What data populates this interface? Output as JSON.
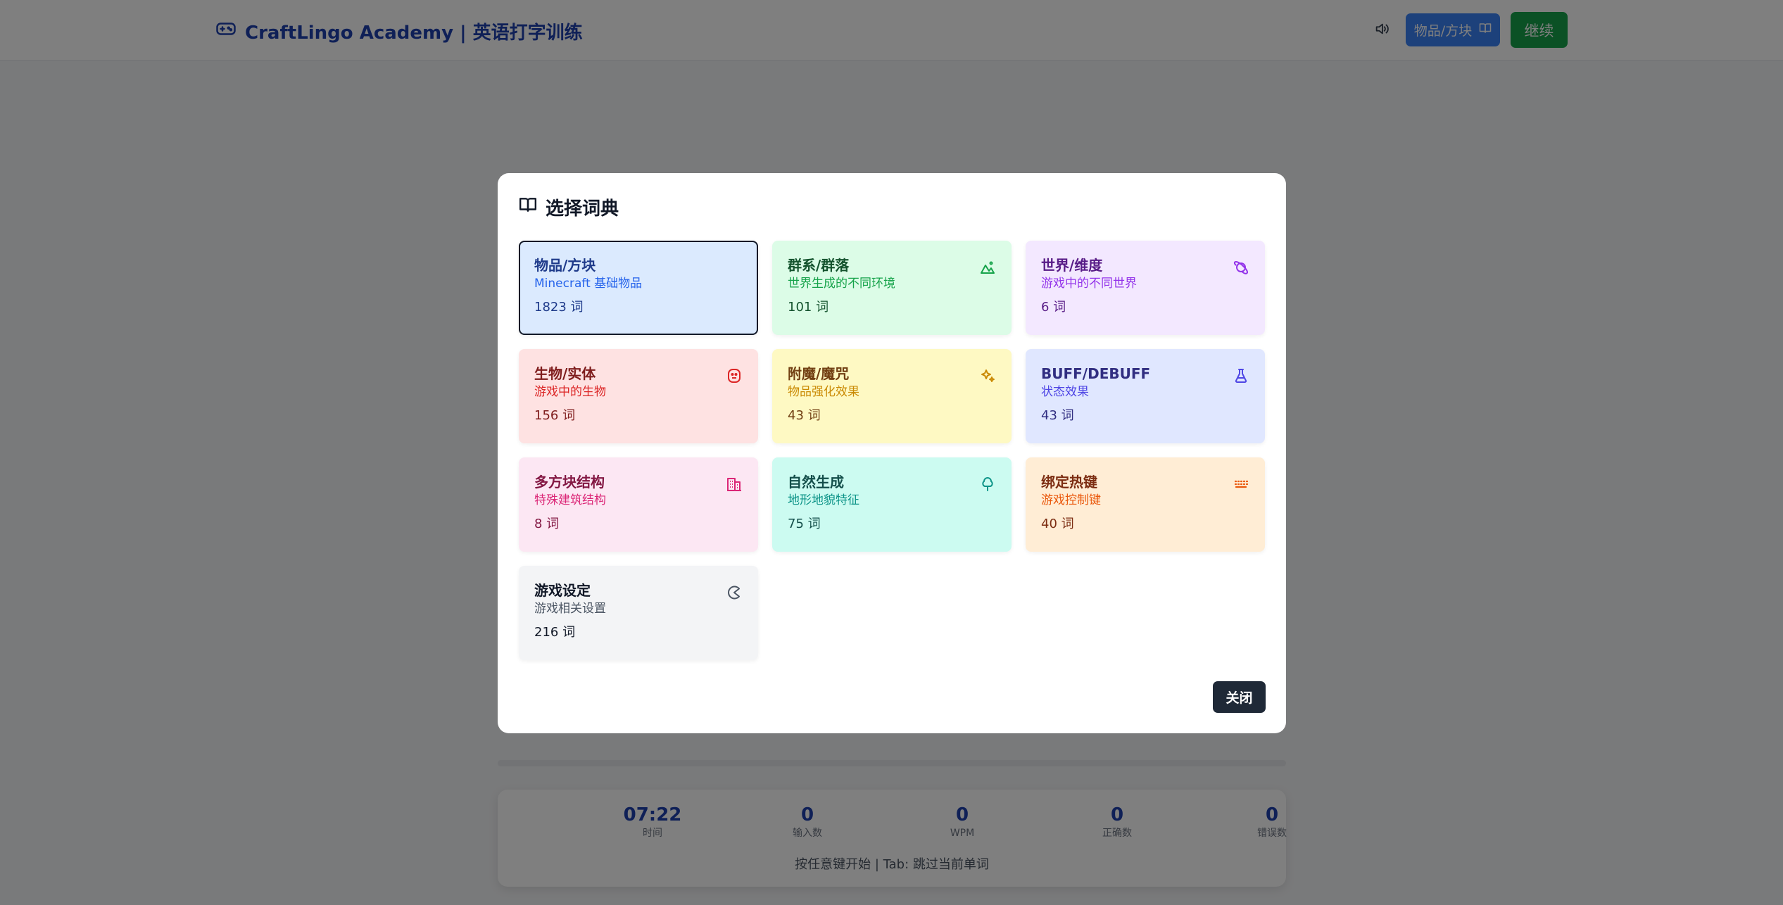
{
  "header": {
    "brand_icon": "gamepad-icon",
    "title": "CraftLingo Academy | 英语打字训练",
    "sound_icon": "speaker-icon",
    "dictionary_button": "物品/方块",
    "dictionary_icon": "book-open-icon",
    "continue_button": "继续",
    "colors": {
      "brand": "#1e40af",
      "primary_button": "#3b82f6",
      "continue_button": "#16a34a"
    }
  },
  "stats": {
    "items": [
      {
        "value": "07:22",
        "label": "时间"
      },
      {
        "value": "0",
        "label": "输入数"
      },
      {
        "value": "0",
        "label": "WPM"
      },
      {
        "value": "0",
        "label": "正确数"
      },
      {
        "value": "0",
        "label": "错误数"
      }
    ],
    "hint": "按任意键开始 | Tab: 跳过当前单词"
  },
  "modal": {
    "title_icon": "book-open-icon",
    "title": "选择词典",
    "close_button": "关闭",
    "dictionaries": [
      {
        "name": "物品/方块",
        "desc": "Minecraft 基础物品",
        "count": "1823 词",
        "icon": "",
        "selected": true,
        "bg": "#dbeafe",
        "fg": "#1e3a8a",
        "sub": "#2563eb"
      },
      {
        "name": "群系/群落",
        "desc": "世界生成的不同环境",
        "count": "101 词",
        "icon": "mountain-icon",
        "selected": false,
        "bg": "#dcfce7",
        "fg": "#14532d",
        "sub": "#16a34a"
      },
      {
        "name": "世界/维度",
        "desc": "游戏中的不同世界",
        "count": "6 词",
        "icon": "planet-icon",
        "selected": false,
        "bg": "#f3e8ff",
        "fg": "#581c87",
        "sub": "#9333ea"
      },
      {
        "name": "生物/实体",
        "desc": "游戏中的生物",
        "count": "156 词",
        "icon": "ghost-icon",
        "selected": false,
        "bg": "#fee2e2",
        "fg": "#7f1d1d",
        "sub": "#dc2626"
      },
      {
        "name": "附魔/魔咒",
        "desc": "物品强化效果",
        "count": "43 词",
        "icon": "sparkles-icon",
        "selected": false,
        "bg": "#fef9c3",
        "fg": "#713f12",
        "sub": "#ca8a04"
      },
      {
        "name": "BUFF/DEBUFF",
        "desc": "状态效果",
        "count": "43 词",
        "icon": "flask-icon",
        "selected": false,
        "bg": "#e0e7ff",
        "fg": "#312e81",
        "sub": "#4f46e5"
      },
      {
        "name": "多方块结构",
        "desc": "特殊建筑结构",
        "count": "8 词",
        "icon": "building-icon",
        "selected": false,
        "bg": "#fce7f3",
        "fg": "#831843",
        "sub": "#db2777"
      },
      {
        "name": "自然生成",
        "desc": "地形地貌特征",
        "count": "75 词",
        "icon": "tree-icon",
        "selected": false,
        "bg": "#ccfbf1",
        "fg": "#134e4a",
        "sub": "#0d9488"
      },
      {
        "name": "绑定热键",
        "desc": "游戏控制键",
        "count": "40 词",
        "icon": "keyboard-icon",
        "selected": false,
        "bg": "#ffedd5",
        "fg": "#7c2d12",
        "sub": "#ea580c"
      },
      {
        "name": "游戏设定",
        "desc": "游戏相关设置",
        "count": "216 词",
        "icon": "pacman-icon",
        "selected": false,
        "bg": "#f3f4f6",
        "fg": "#111827",
        "sub": "#4b5563"
      }
    ]
  }
}
